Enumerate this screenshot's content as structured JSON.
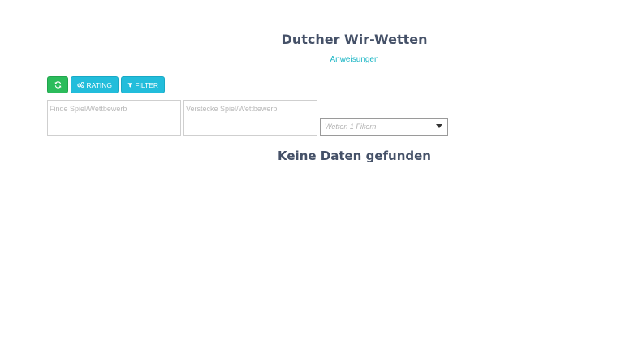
{
  "page": {
    "title": "Dutcher Wir-Wetten",
    "instructions_link": "Anweisungen"
  },
  "toolbar": {
    "refresh_icon": "refresh-icon",
    "rating_label": "RATING",
    "rating_icon": "gears-icon",
    "filter_label": "FILTER",
    "filter_icon": "funnel-icon"
  },
  "search": {
    "find_placeholder": "Finde Spiel/Wettbewerb",
    "hide_placeholder": "Verstecke Spiel/Wettbewerb"
  },
  "filter_select": {
    "placeholder": "Wetten 1 Filtern"
  },
  "results": {
    "empty_message": "Keine Daten gefunden"
  },
  "colors": {
    "accent_green": "#2bbc5b",
    "accent_cyan": "#22bddb",
    "link": "#19b5c4",
    "heading": "#455168"
  }
}
